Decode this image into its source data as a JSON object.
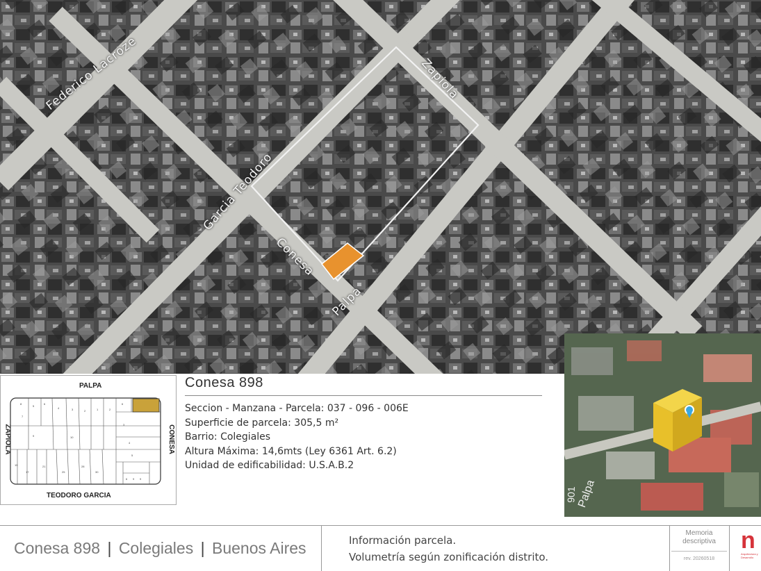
{
  "map": {
    "streets": {
      "federico_lacroze": "Federico Lacroze",
      "zapiola": "Zapiola",
      "garcia_teodoro": "Garcia Teodoro",
      "conesa": "Conesa",
      "palpa": "Palpa"
    },
    "highlight_color": "#e8922e"
  },
  "plan": {
    "street_top": "PALPA",
    "street_bottom": "TEODORO GARCIA",
    "street_left": "ZAPIOLA",
    "street_right": "CONESA",
    "highlight_color": "#c9a23a"
  },
  "info": {
    "title": "Conesa 898",
    "lines": [
      "Seccion - Manzana - Parcela: 037 - 096 - 006E",
      "Superficie de parcela: 305,5 m²",
      "Barrio: Colegiales",
      "Altura Máxima: 14,6mts (Ley 6361 Art. 6.2)",
      "Unidad de edificabilidad: U.S.A.B.2"
    ]
  },
  "view3d": {
    "street_label": "Palpa",
    "street_number": "901",
    "volume_color": "#e8c02a",
    "pin_color": "#3aa7e0"
  },
  "footer": {
    "location_parts": [
      "Conesa 898",
      "Colegiales",
      "Buenos Aires"
    ],
    "separator": "|",
    "description_lines": [
      "Información parcela.",
      "Volumetría según zonificación distrito."
    ],
    "memo_line1": "Memoria",
    "memo_line2": "descriptiva",
    "revision": "rev. 20260518",
    "logo_letters": "n",
    "logo_caption": "Arquitectura y Desarrollo",
    "logo_color": "#d6333a"
  }
}
